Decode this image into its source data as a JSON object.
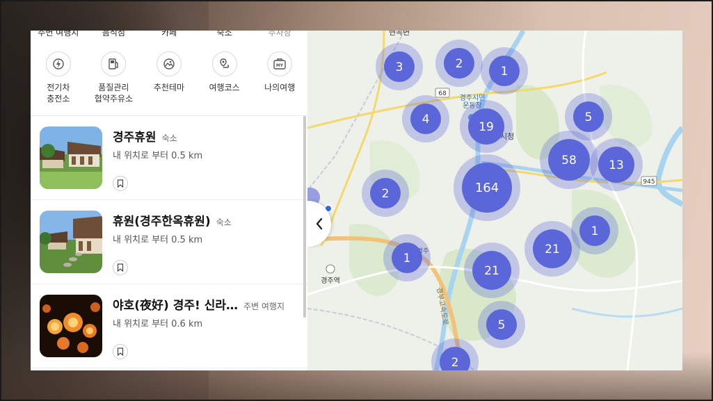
{
  "categories": [
    "주변 여행지",
    "음식점",
    "카페",
    "숙소",
    "주차장"
  ],
  "quick_menu": [
    {
      "label": "전기차\n충전소",
      "icon": "ev-charger-icon"
    },
    {
      "label": "품질관리\n협약주유소",
      "icon": "gas-station-icon"
    },
    {
      "label": "추천테마",
      "icon": "theme-icon"
    },
    {
      "label": "여행코스",
      "icon": "route-icon"
    },
    {
      "label": "나의여행",
      "icon": "my-trip-icon",
      "badge": "MY"
    }
  ],
  "places": [
    {
      "title": "경주휴원",
      "type": "숙소",
      "distance": "내 위치로 부터 0.5 km"
    },
    {
      "title": "휴원(경주한옥휴원)",
      "type": "숙소",
      "distance": "내 위치로 부터 0.5 km"
    },
    {
      "title": "야호(夜好) 경주! 신라…",
      "type": "주변 여행지",
      "distance": "내 위치로 부터 0.6 km"
    }
  ],
  "map": {
    "labels": {
      "top_partial": "현곡면",
      "stadium": "경주시민\n운동장",
      "city_hall": "경주시청",
      "station": "경주역",
      "road_68": "68",
      "road_945": "945",
      "expressway": "경부고속도로",
      "area_partial": "경주"
    },
    "clusters": [
      {
        "count": "3"
      },
      {
        "count": "2"
      },
      {
        "count": "1"
      },
      {
        "count": "4"
      },
      {
        "count": "19"
      },
      {
        "count": "5"
      },
      {
        "count": "58"
      },
      {
        "count": "13"
      },
      {
        "count": "2"
      },
      {
        "count": "164"
      },
      {
        "count": "1"
      },
      {
        "count": "1"
      },
      {
        "count": "21"
      },
      {
        "count": "21"
      },
      {
        "count": "5"
      },
      {
        "count": "2"
      }
    ],
    "cluster_color": "#5b67d8"
  }
}
